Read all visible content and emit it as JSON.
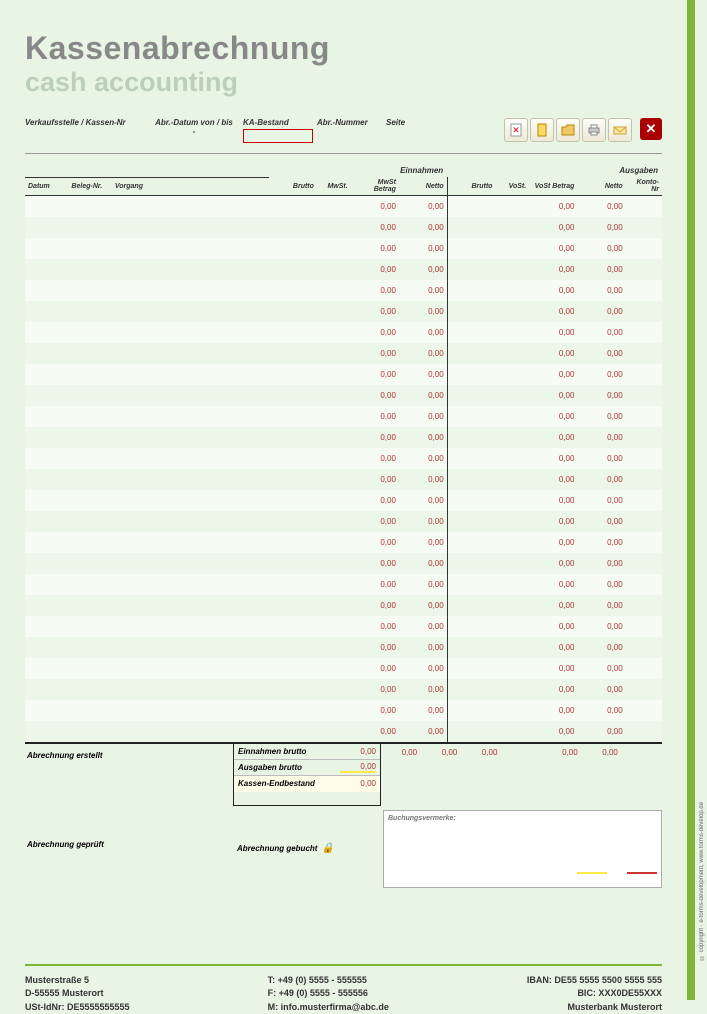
{
  "title_de": "Kassenabrechnung",
  "title_en": "cash accounting",
  "sidebar_text": "© copyright · e-forms-development, www.forms-develop.de",
  "header": {
    "pos_label": "Verkaufsstelle / Kassen-Nr",
    "date_label": "Abr.-Datum von / bis",
    "date_sep": "-",
    "ka_label": "KA-Bestand",
    "nr_label": "Abr.-Nummer",
    "seite_label": "Seite"
  },
  "columns": {
    "datum": "Datum",
    "beleg": "Beleg-Nr.",
    "vorgang": "Vorgang",
    "brutto": "Brutto",
    "mwst": "MwSt.",
    "mwst_betrag": "MwSt Betrag",
    "netto": "Netto",
    "vost": "VoSt.",
    "vost_betrag": "VoSt Betrag",
    "konto": "Konto-Nr",
    "einnahmen": "Einnahmen",
    "ausgaben": "Ausgaben"
  },
  "zero": "0,00",
  "totals": {
    "erstellt": "Abrechnung erstellt",
    "geprueft": "Abrechnung geprüft",
    "gebucht": "Abrechnung gebucht",
    "einnahmen_brutto": "Einnahmen brutto",
    "ausgaben_brutto": "Ausgaben brutto",
    "endbestand": "Kassen-Endbestand",
    "einnahmen_val": "0,00",
    "ausgaben_val": "0,00",
    "endbestand_val": "0,00"
  },
  "notes_label": "Buchungsvermerke:",
  "footer": {
    "addr1": "Musterstraße 5",
    "addr2": "D-55555 Musterort",
    "addr3": "USt-IdNr: DE5555555555",
    "tel": "T: +49 (0) 5555 - 555555",
    "fax": "F: +49 (0) 5555 - 555556",
    "mail": "M: info.musterfirma@abc.de",
    "iban": "IBAN: DE55 5555 5500 5555 555",
    "bic": "BIC: XXX0DE55XXX",
    "bank": "Musterbank Musterort"
  }
}
